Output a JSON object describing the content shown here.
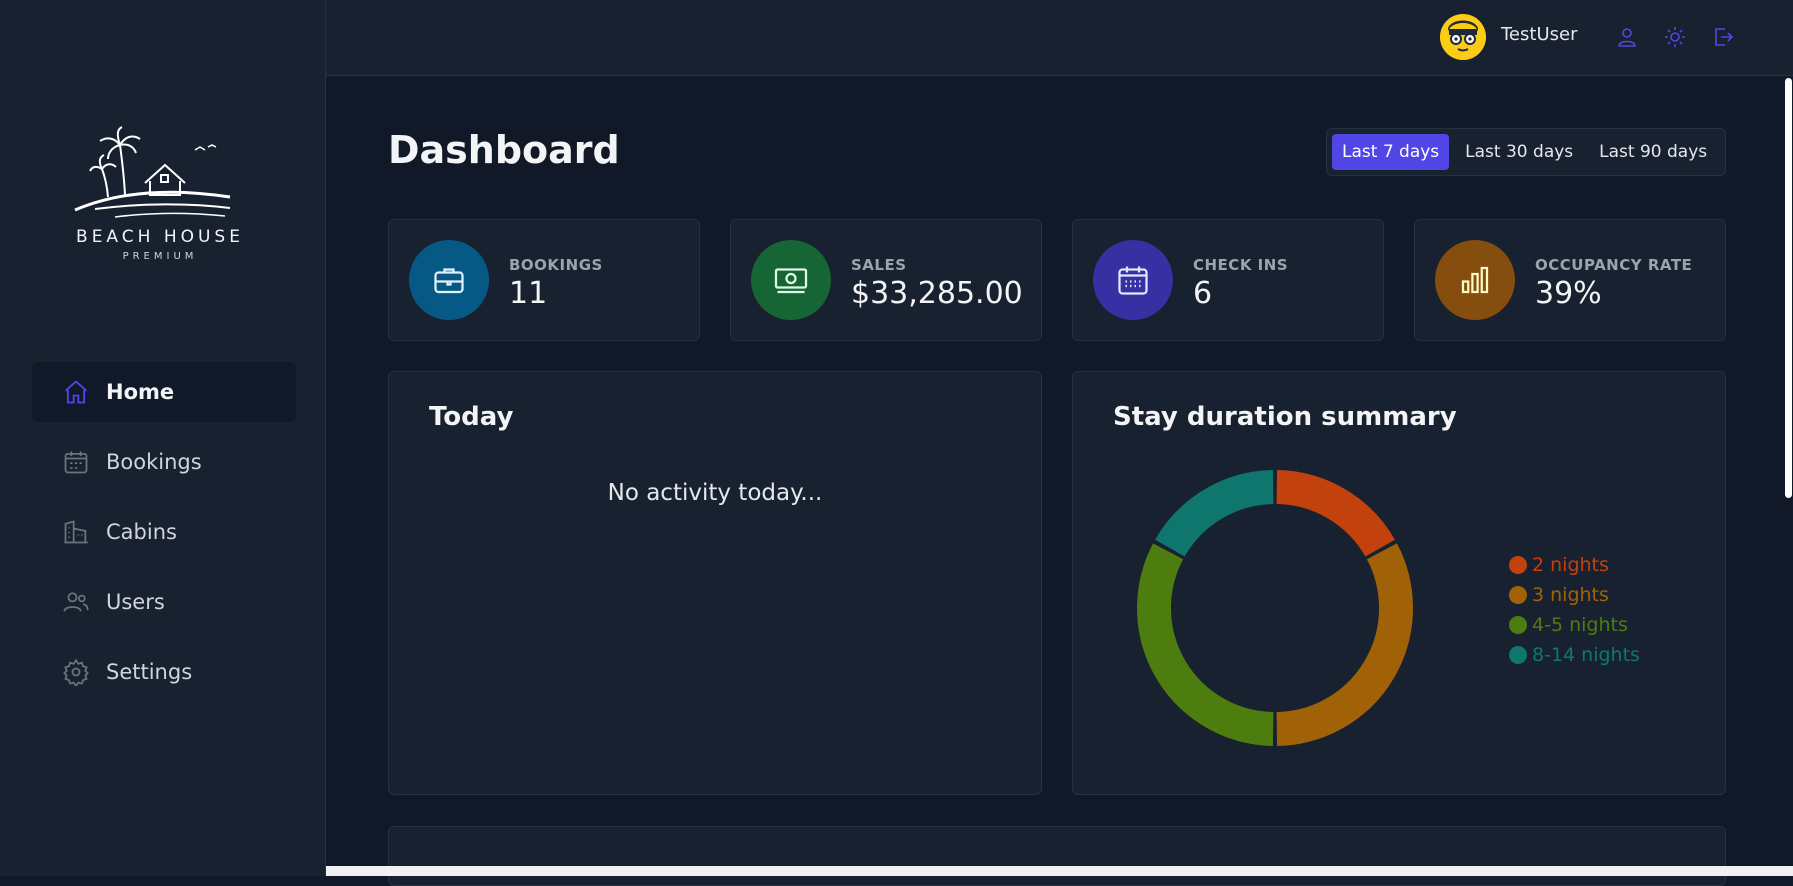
{
  "brand": {
    "name": "BEACH HOUSE",
    "tagline": "PREMIUM"
  },
  "sidebar": {
    "items": [
      {
        "label": "Home",
        "icon": "home-icon",
        "active": true
      },
      {
        "label": "Bookings",
        "icon": "calendar-icon"
      },
      {
        "label": "Cabins",
        "icon": "building-icon"
      },
      {
        "label": "Users",
        "icon": "users-icon"
      },
      {
        "label": "Settings",
        "icon": "gear-icon"
      }
    ]
  },
  "header": {
    "username": "TestUser",
    "actions": [
      "user-icon",
      "sun-icon",
      "logout-icon"
    ]
  },
  "main": {
    "title": "Dashboard",
    "filters": [
      {
        "label": "Last 7 days",
        "active": true
      },
      {
        "label": "Last 30 days"
      },
      {
        "label": "Last 90 days"
      }
    ],
    "stats": [
      {
        "label": "BOOKINGS",
        "value": "11",
        "color": "#075985",
        "icon": "briefcase-icon"
      },
      {
        "label": "SALES",
        "value": "$33,285.00",
        "color": "#166534",
        "icon": "banknotes-icon"
      },
      {
        "label": "CHECK INS",
        "value": "6",
        "color": "#3730a3",
        "icon": "calendar-days-icon"
      },
      {
        "label": "OCCUPANCY RATE",
        "value": "39%",
        "color": "#854d0e",
        "icon": "chart-bar-icon"
      }
    ],
    "today": {
      "title": "Today",
      "empty_text": "No activity today..."
    },
    "duration": {
      "title": "Stay duration summary"
    }
  },
  "chart_data": {
    "type": "pie",
    "categories": [
      "2 nights",
      "3 nights",
      "4-5 nights",
      "8-14 nights"
    ],
    "values": [
      17,
      33,
      33,
      17
    ],
    "colors": [
      "#c2410c",
      "#a16207",
      "#4d7c0f",
      "#0f766e"
    ],
    "legend": "right"
  }
}
